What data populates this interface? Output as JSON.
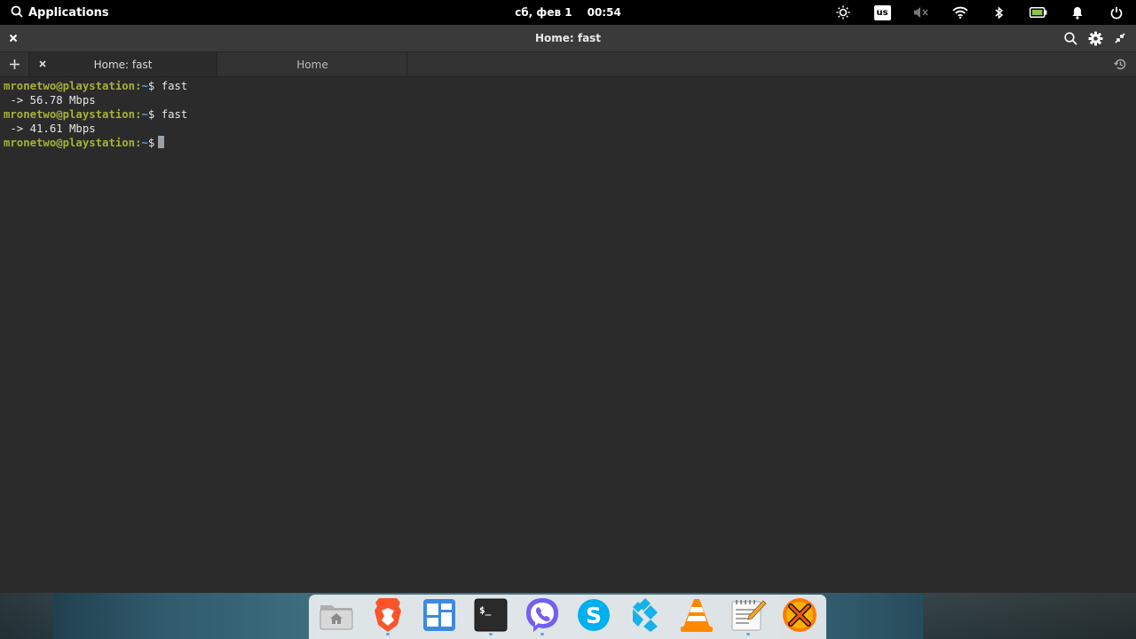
{
  "panel": {
    "applications_label": "Applications",
    "date": "сб, фев  1",
    "time": "00:54",
    "keyboard_layout": "us",
    "icons": [
      "night-light-icon",
      "keyboard-layout-indicator",
      "volume-muted-icon",
      "wifi-icon",
      "bluetooth-icon",
      "battery-icon",
      "notifications-icon",
      "power-icon"
    ]
  },
  "window": {
    "title": "Home: fast",
    "close_icon": "close-icon",
    "actions": [
      "search-icon",
      "gear-icon",
      "unmaximize-icon"
    ]
  },
  "tabs": {
    "new_tab_icon": "plus-icon",
    "items": [
      {
        "label": "Home: fast",
        "active": true
      },
      {
        "label": "Home",
        "active": false
      }
    ],
    "history_icon": "history-icon"
  },
  "terminal": {
    "lines": [
      {
        "prompt": "mronetwo@playstation:",
        "path": "~",
        "symbol": "$",
        "command": " fast"
      },
      {
        "output": " -> 56.78 Mbps"
      },
      {
        "prompt": "mronetwo@playstation:",
        "path": "~",
        "symbol": "$",
        "command": " fast"
      },
      {
        "output": " -> 41.61 Mbps"
      },
      {
        "prompt": "mronetwo@playstation:",
        "path": "~",
        "symbol": "$",
        "command": ""
      }
    ]
  },
  "dock": {
    "items": [
      {
        "name": "files-icon",
        "running": false
      },
      {
        "name": "brave-browser-icon",
        "running": true
      },
      {
        "name": "multitasking-view-icon",
        "running": false
      },
      {
        "name": "terminal-icon",
        "running": true
      },
      {
        "name": "viber-icon",
        "running": true
      },
      {
        "name": "skype-icon",
        "running": false
      },
      {
        "name": "kodi-icon",
        "running": false
      },
      {
        "name": "vlc-icon",
        "running": false
      },
      {
        "name": "text-editor-icon",
        "running": true
      },
      {
        "name": "crossover-icon",
        "running": false
      }
    ]
  },
  "colors": {
    "prompt": "#a5b236",
    "terminal_bg": "#2b2b2b",
    "panel_bg": "#000000",
    "running_dot": "#66a2e8"
  }
}
